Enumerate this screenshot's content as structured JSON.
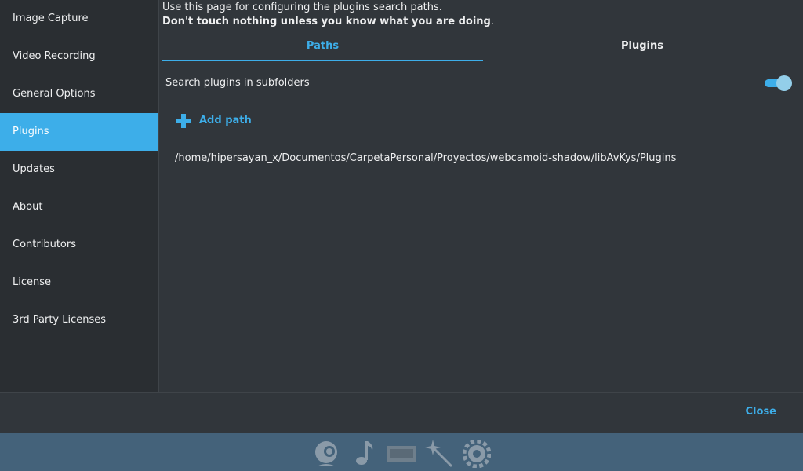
{
  "sidebar": {
    "items": [
      {
        "label": "Image Capture"
      },
      {
        "label": "Video Recording"
      },
      {
        "label": "General Options"
      },
      {
        "label": "Plugins"
      },
      {
        "label": "Updates"
      },
      {
        "label": "About"
      },
      {
        "label": "Contributors"
      },
      {
        "label": "License"
      },
      {
        "label": "3rd Party Licenses"
      }
    ],
    "active": "Plugins"
  },
  "main": {
    "description": "Use this page for configuring the plugins search paths.",
    "warning": "Don't touch nothing unless you know what you are doing",
    "warning_end": ".",
    "tabs": [
      {
        "label": "Paths",
        "active": true
      },
      {
        "label": "Plugins",
        "active": false
      }
    ],
    "search_subfolders": {
      "label": "Search plugins in subfolders",
      "enabled": true
    },
    "add_path_label": "Add path",
    "paths": [
      "/home/hipersayan_x/Documentos/CarpetaPersonal/Proyectos/webcamoid-shadow/libAvKys/Plugins"
    ]
  },
  "footer": {
    "close_label": "Close"
  },
  "bottom_toolbar": {
    "icons": [
      "webcam-icon",
      "music-note-icon",
      "video-film-icon",
      "magic-wand-icon",
      "gear-icon"
    ]
  },
  "colors": {
    "accent": "#3daee9",
    "background": "#31363b",
    "sidebar": "#2a2e32",
    "toolbar": "#44627a"
  }
}
